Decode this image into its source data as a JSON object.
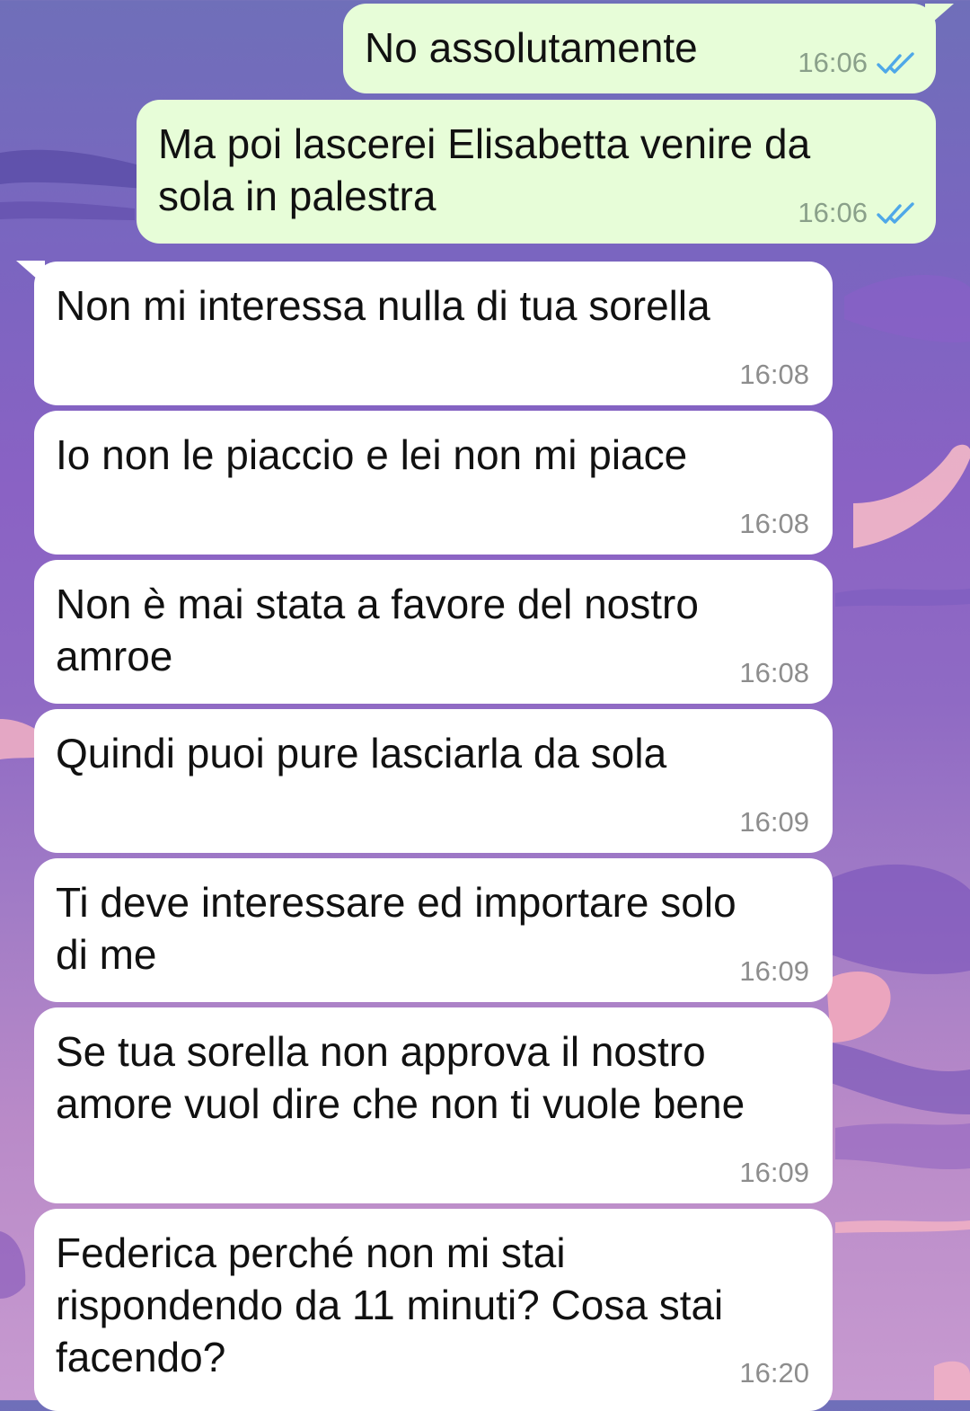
{
  "colors": {
    "outgoing_bubble": "#e7fdd8",
    "incoming_bubble": "#ffffff",
    "read_ticks": "#4fa8e8",
    "time_text": "#8d8d8d"
  },
  "messages": [
    {
      "direction": "out",
      "text": "No assolutamente",
      "time": "16:06",
      "status": "read",
      "status_icon": "double-check-icon"
    },
    {
      "direction": "out",
      "text": "Ma poi lascerei Elisabetta venire da\nsola in palestra",
      "time": "16:06",
      "status": "read",
      "status_icon": "double-check-icon"
    },
    {
      "direction": "in",
      "text": "Non mi interessa nulla di tua sorella",
      "time": "16:08"
    },
    {
      "direction": "in",
      "text": "Io non le piaccio e lei non mi piace",
      "time": "16:08"
    },
    {
      "direction": "in",
      "text": "Non è mai stata a favore del nostro\namroe",
      "time": "16:08"
    },
    {
      "direction": "in",
      "text": "Quindi puoi pure lasciarla da sola",
      "time": "16:09"
    },
    {
      "direction": "in",
      "text": "Ti deve interessare ed importare solo\ndi me",
      "time": "16:09"
    },
    {
      "direction": "in",
      "text": "Se tua sorella non approva il nostro\namore vuol dire che non ti vuole bene",
      "time": "16:09"
    },
    {
      "direction": "in",
      "text": "Federica perché non mi stai\nrispondendo da 11 minuti? Cosa stai\nfacendo?",
      "time": "16:20"
    }
  ]
}
